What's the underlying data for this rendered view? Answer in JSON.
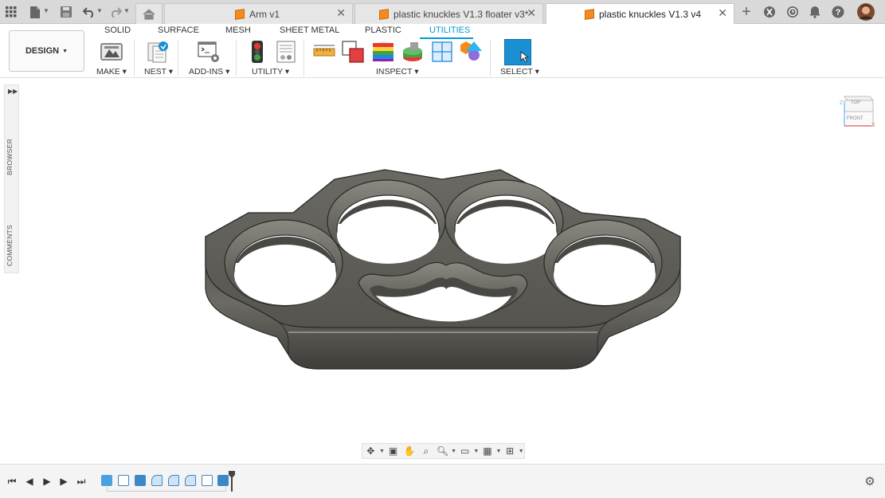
{
  "tabs": {
    "items": [
      {
        "label": "Arm v1"
      },
      {
        "label": "plastic knuckles V1.3 floater v3*"
      },
      {
        "label": "plastic knuckles V1.3 v4"
      }
    ]
  },
  "workspace": {
    "label": "DESIGN"
  },
  "ribbon": {
    "tabs": [
      "SOLID",
      "SURFACE",
      "MESH",
      "SHEET METAL",
      "PLASTIC",
      "UTILITIES"
    ],
    "active_tab": "UTILITIES",
    "groups": {
      "make": "MAKE",
      "nest": "NEST",
      "addins": "ADD-INS",
      "utility": "UTILITY",
      "inspect": "INSPECT",
      "select": "SELECT"
    }
  },
  "panel": {
    "browser": "BROWSER",
    "comments": "COMMENTS"
  },
  "viewcube": {
    "top": "TOP",
    "front": "FRONT",
    "axis_x": "X",
    "axis_z": "Z"
  },
  "colors": {
    "accent": "#0696d7",
    "model_fill": "#5f5d58",
    "select_button": "#1a8fd1"
  }
}
